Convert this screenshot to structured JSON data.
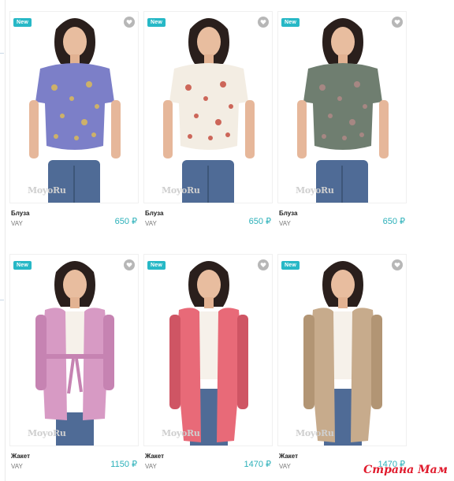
{
  "products": [
    {
      "badge": "New",
      "title": "Блуза",
      "brand": "VAY",
      "price": "650 ₽",
      "watermark": "MoyoRu",
      "pattern": "#7c7fc8",
      "accent": "#e9c24a",
      "sleeve": "short-offshoulder"
    },
    {
      "badge": "New",
      "title": "Блуза",
      "brand": "VAY",
      "price": "650 ₽",
      "watermark": "MoyoRu",
      "pattern": "#f3ede3",
      "accent": "#c0392b",
      "sleeve": "short-offshoulder"
    },
    {
      "badge": "New",
      "title": "Блуза",
      "brand": "VAY",
      "price": "650 ₽",
      "watermark": "MoyoRu",
      "pattern": "#6f7e70",
      "accent": "#b98a8a",
      "sleeve": "short"
    },
    {
      "badge": "New",
      "title": "Жакет",
      "brand": "VAY",
      "price": "1150 ₽",
      "watermark": "MoyoRu",
      "pattern": "#d79ac4",
      "accent": "#c683b2",
      "sleeve": "wrap"
    },
    {
      "badge": "New",
      "title": "Жакет",
      "brand": "VAY",
      "price": "1470 ₽",
      "watermark": "MoyoRu",
      "pattern": "#e86a78",
      "accent": "#cf5564",
      "sleeve": "long-cardigan"
    },
    {
      "badge": "New",
      "title": "Жакет",
      "brand": "VAY",
      "price": "1470 ₽",
      "watermark": "MoyoRu",
      "pattern": "#c7ab8c",
      "accent": "#b29574",
      "sleeve": "long-cardigan"
    }
  ],
  "overlay_logo": "Страна Мам",
  "icons": {
    "favorite": "heart-icon"
  }
}
